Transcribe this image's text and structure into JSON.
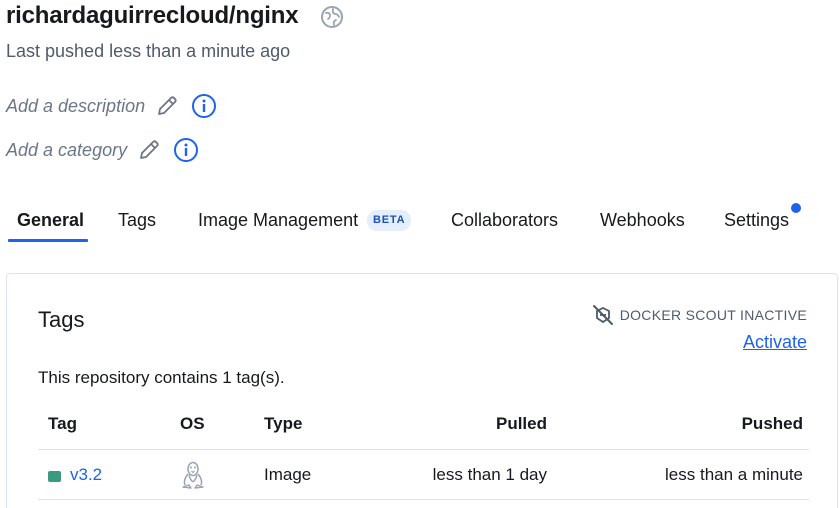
{
  "repo": {
    "name": "richardaguirrecloud/nginx",
    "visibility_icon": "globe-public-icon",
    "last_pushed": "Last pushed less than a minute ago"
  },
  "meta": {
    "description_placeholder": "Add a description",
    "category_placeholder": "Add a category"
  },
  "tabs": {
    "items": [
      {
        "label": "General",
        "active": true
      },
      {
        "label": "Tags"
      },
      {
        "label": "Image Management",
        "badge": "BETA"
      },
      {
        "label": "Collaborators"
      },
      {
        "label": "Webhooks"
      },
      {
        "label": "Settings",
        "notification_dot": true
      }
    ]
  },
  "tags_card": {
    "title": "Tags",
    "scout_status": "DOCKER SCOUT INACTIVE",
    "activate_label": "Activate",
    "count_text": "This repository contains 1 tag(s).",
    "columns": [
      "Tag",
      "OS",
      "Type",
      "Pulled",
      "Pushed"
    ],
    "rows": [
      {
        "tag": "v3.2",
        "os_icon": "linux-tux-icon",
        "type": "Image",
        "pulled": "less than 1 day",
        "pushed": "less than a minute",
        "status_color": "#3a9b80"
      }
    ]
  },
  "colors": {
    "accent": "#1d63ed",
    "text": "#17191e",
    "muted": "#505a6b",
    "border": "#dfe3ea",
    "tag_status": "#3a9b80"
  }
}
